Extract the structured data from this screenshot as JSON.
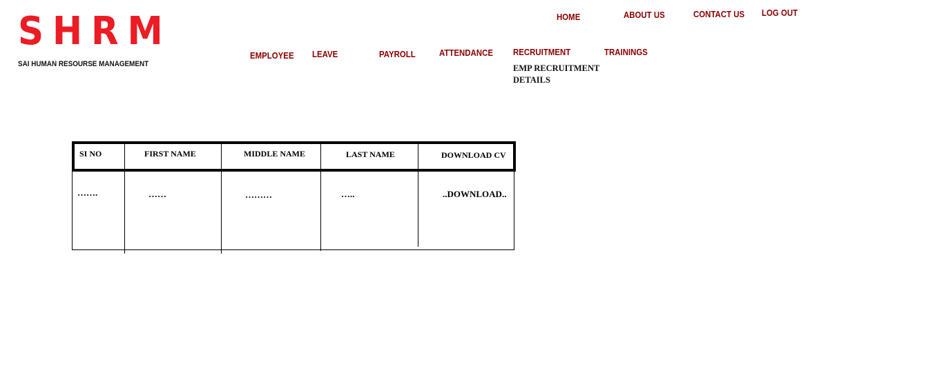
{
  "brand": {
    "logo": "SHRM",
    "tagline": "SAI HUMAN RESOURSE MANAGEMENT"
  },
  "top_nav": {
    "home": "HOME",
    "about": "ABOUT US",
    "contact": "CONTACT US",
    "logout": "LOG OUT"
  },
  "main_nav": {
    "employee": "EMPLOYEE",
    "leave": "LEAVE",
    "payroll": "PAYROLL",
    "attendance": "ATTENDANCE",
    "recruitment": "RECRUITMENT",
    "trainings": "TRAININGS",
    "recruitment_sub": "EMP RECRUITMENT DETAILS"
  },
  "table": {
    "headers": [
      "SI NO",
      "FIRST NAME",
      "MIDDLE NAME",
      "LAST NAME",
      "DOWNLOAD CV"
    ],
    "row": [
      "…….",
      "……",
      "………",
      "…..",
      "..DOWNLOAD.."
    ]
  },
  "colors": {
    "brand_red": "#ec1c24",
    "nav_red": "#8b0000"
  }
}
